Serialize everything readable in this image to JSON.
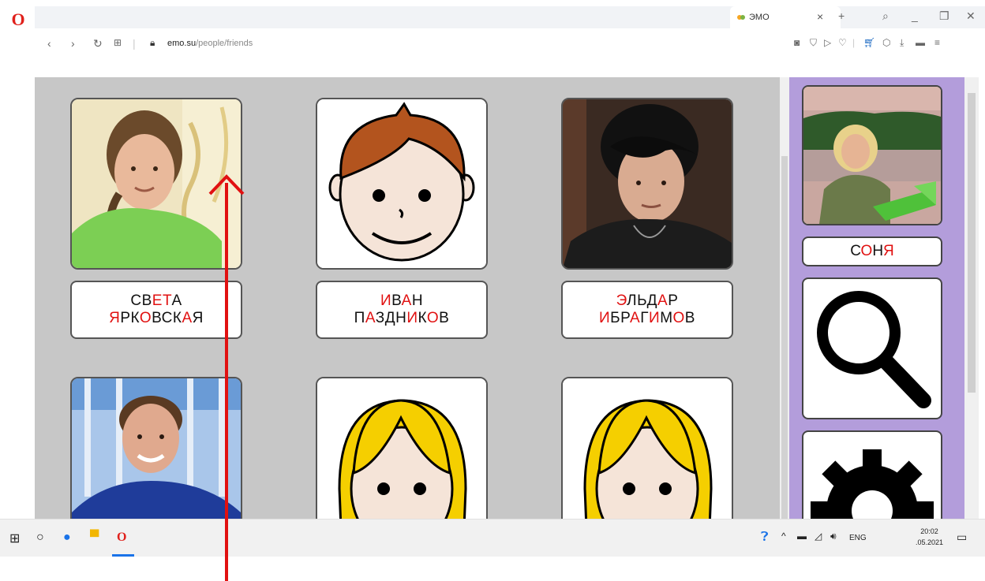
{
  "browser": {
    "tab_title": "ЭМО",
    "url_host": "emo.su",
    "url_path": "/people/friends"
  },
  "cards": [
    {
      "first": [
        [
          "СВ",
          0
        ],
        [
          "ЕТ",
          1
        ],
        [
          "А",
          0
        ]
      ],
      "last": [
        [
          "Я",
          1
        ],
        [
          "РК",
          0
        ],
        [
          "О",
          1
        ],
        [
          "ВСК",
          0
        ],
        [
          "А",
          1
        ],
        [
          "Я",
          0
        ]
      ]
    },
    {
      "first": [
        [
          "И",
          1
        ],
        [
          "В",
          0
        ],
        [
          "А",
          1
        ],
        [
          "Н",
          0
        ]
      ],
      "last": [
        [
          "П",
          0
        ],
        [
          "А",
          1
        ],
        [
          "ЗДН",
          0
        ],
        [
          "И",
          1
        ],
        [
          "К",
          0
        ],
        [
          "О",
          1
        ],
        [
          "В",
          0
        ]
      ]
    },
    {
      "first": [
        [
          "Э",
          1
        ],
        [
          "ЛЬД",
          0
        ],
        [
          "А",
          1
        ],
        [
          "Р",
          0
        ]
      ],
      "last": [
        [
          "И",
          1
        ],
        [
          "БР",
          0
        ],
        [
          "А",
          1
        ],
        [
          "Г",
          0
        ],
        [
          "И",
          1
        ],
        [
          "М",
          0
        ],
        [
          "О",
          1
        ],
        [
          "В",
          0
        ]
      ]
    }
  ],
  "sidebar": {
    "name_label": [
      [
        "С",
        0
      ],
      [
        "О",
        1
      ],
      [
        "Н",
        0
      ],
      [
        "Я",
        1
      ]
    ]
  },
  "taskbar": {
    "lang": "ENG",
    "time": "20:02",
    "date": ".05.2021"
  },
  "colors": {
    "accent_red": "#e11111",
    "sidebar_purple": "#b39ddb",
    "grid_gray": "#c7c7c7"
  }
}
